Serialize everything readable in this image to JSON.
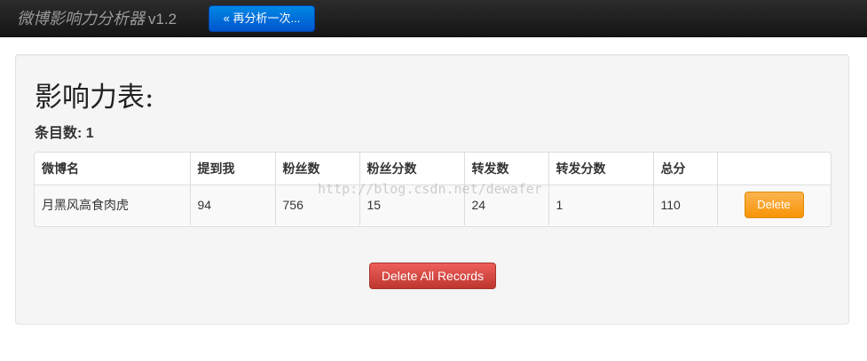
{
  "navbar": {
    "brand": "微博影响力分析器",
    "version": "v1.2",
    "reanalyze_label": "« 再分析一次..."
  },
  "main": {
    "title": "影响力表:",
    "count_label": "条目数:",
    "count_value": "1",
    "table": {
      "headers": [
        "微博名",
        "提到我",
        "粉丝数",
        "粉丝分数",
        "转发数",
        "转发分数",
        "总分",
        ""
      ],
      "rows": [
        {
          "cells": [
            "月黑风高食肉虎",
            "94",
            "756",
            "15",
            "24",
            "1",
            "110"
          ],
          "action_label": "Delete"
        }
      ]
    },
    "delete_all_label": "Delete All Records"
  },
  "watermark": "http://blog.csdn.net/dewafer",
  "colors": {
    "navbar_bg": "#1b1b1b",
    "primary": "#0066dd",
    "warning": "#f89406",
    "danger": "#da4f49"
  }
}
